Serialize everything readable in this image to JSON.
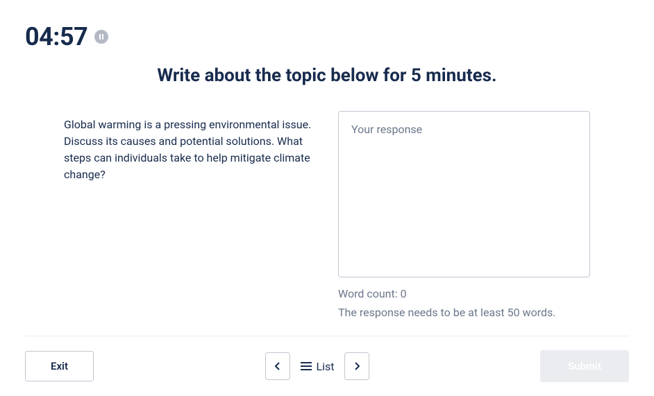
{
  "timer": {
    "value": "04:57"
  },
  "heading": "Write about the topic below for 5 minutes.",
  "prompt": "Global warming is a pressing environmental issue. Discuss its causes and potential solutions. What steps can individuals take to help mitigate climate change?",
  "response": {
    "placeholder": "Your response",
    "value": ""
  },
  "word_count_label": "Word count: 0",
  "hint": "The response needs to be at least 50 words.",
  "footer": {
    "exit_label": "Exit",
    "list_label": "List",
    "submit_label": "Submit"
  }
}
